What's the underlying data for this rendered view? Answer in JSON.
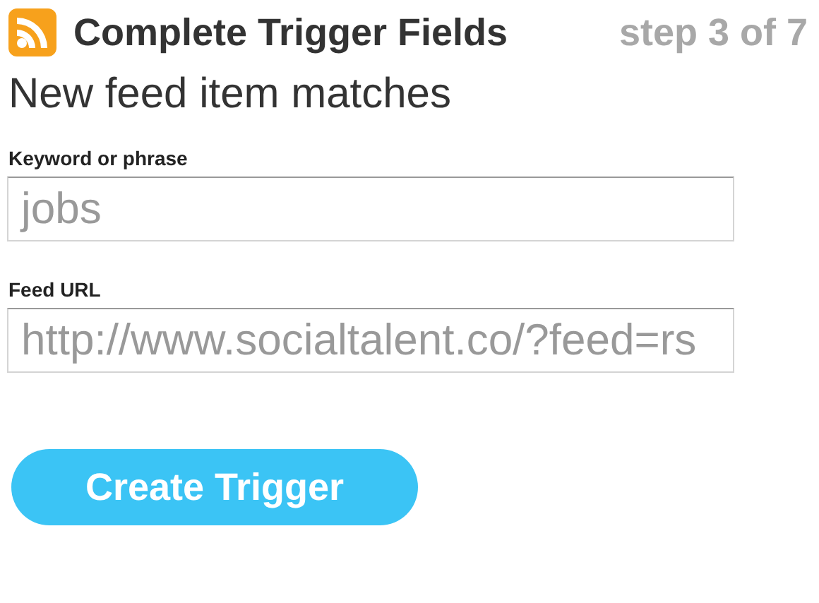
{
  "header": {
    "title": "Complete Trigger Fields",
    "step": "step 3 of 7"
  },
  "subtitle": "New feed item matches",
  "fields": [
    {
      "label": "Keyword or phrase",
      "value": "jobs"
    },
    {
      "label": "Feed URL",
      "value": "http://www.socialtalent.co/?feed=rs"
    }
  ],
  "button": "Create Trigger"
}
